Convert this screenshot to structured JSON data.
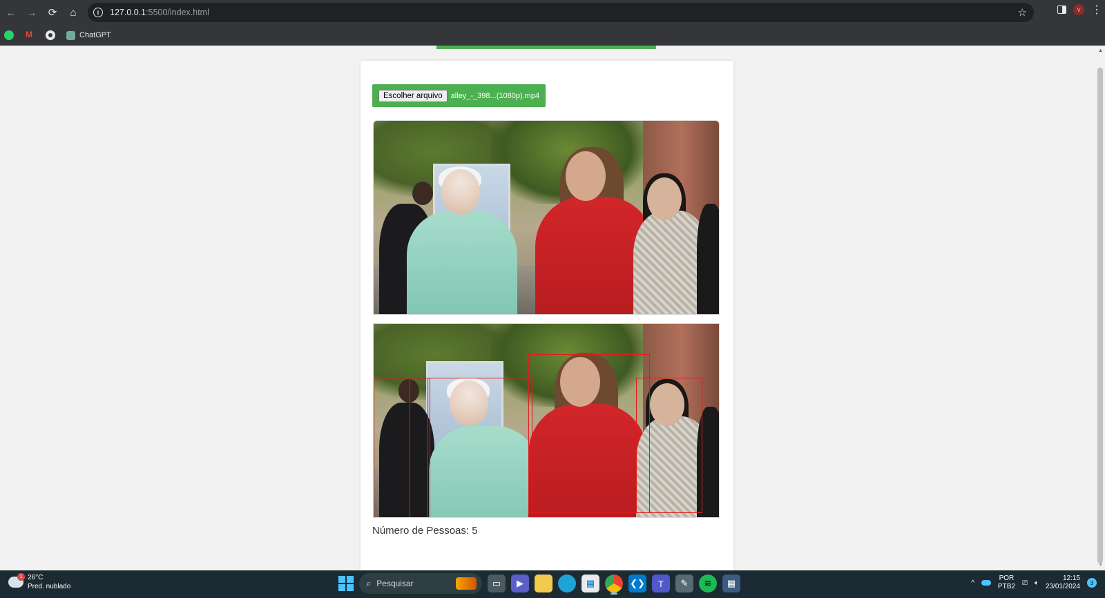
{
  "browser": {
    "url_host": "127.0.0.1",
    "url_path": ":5500/index.html",
    "nav": {
      "back_icon": "arrow-left-icon",
      "forward_icon": "arrow-right-icon",
      "reload_icon": "reload-icon",
      "home_icon": "home-icon"
    },
    "profile_initial": "V",
    "bookmarks": [
      {
        "icon": "whatsapp-icon",
        "label": ""
      },
      {
        "icon": "gmail-icon",
        "label": ""
      },
      {
        "icon": "github-icon",
        "label": ""
      },
      {
        "icon": "chatgpt-icon",
        "label": "ChatGPT"
      }
    ]
  },
  "page": {
    "file_input": {
      "button_label": "Escolher arquivo",
      "file_name": "alley_-_398...(1080p).mp4"
    },
    "result_text": "Número de Pessoas: 5",
    "colors": {
      "accent": "#4caf50",
      "bbox": "#e21b1b"
    }
  },
  "taskbar": {
    "weather_temp": "26°C",
    "weather_desc": "Pred. nublado",
    "weather_badge": "1",
    "search_placeholder": "Pesquisar",
    "lang_top": "POR",
    "lang_bottom": "PTB2",
    "time": "12:15",
    "date": "23/01/2024",
    "notifications": "3"
  }
}
